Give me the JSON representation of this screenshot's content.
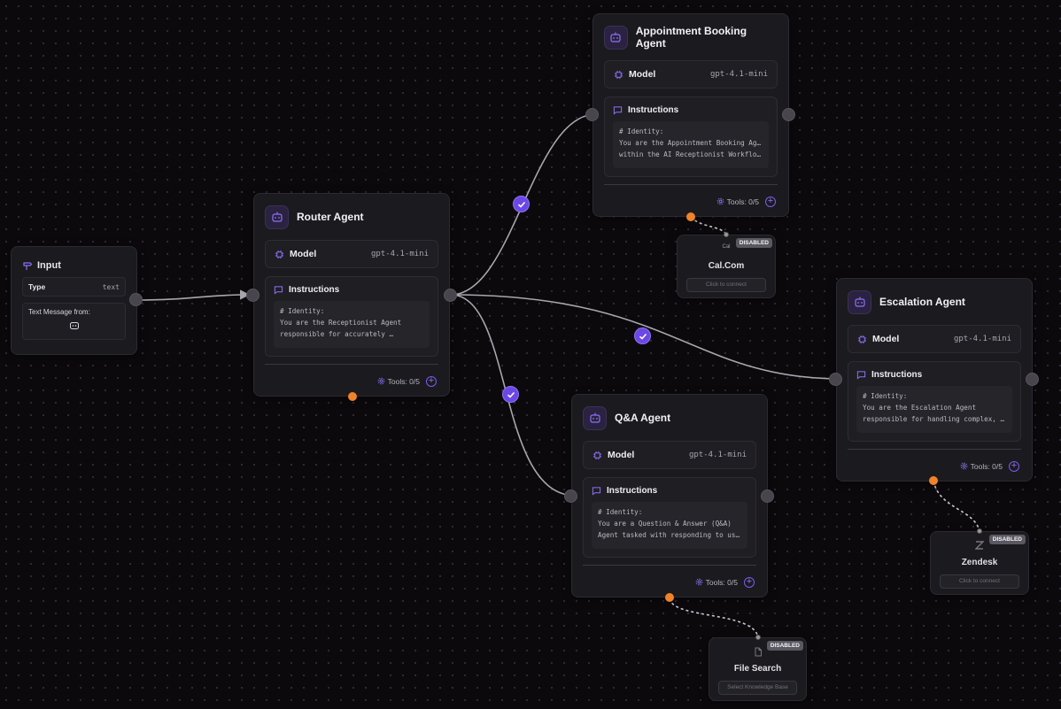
{
  "input_node": {
    "title": "Input",
    "type_label": "Type",
    "type_value": "text",
    "message_label": "Text Message from:"
  },
  "router_agent": {
    "title": "Router Agent",
    "model_label": "Model",
    "model_value": "gpt-4.1-mini",
    "instructions_label": "Instructions",
    "instructions_lines": [
      "# Identity:",
      "You are the Receptionist Agent",
      "responsible for accurately …"
    ],
    "tools_text": "Tools: 0/5"
  },
  "appointment_agent": {
    "title": "Appointment Booking Agent",
    "model_label": "Model",
    "model_value": "gpt-4.1-mini",
    "instructions_label": "Instructions",
    "instructions_lines": [
      "# Identity:",
      "You are the Appointment Booking Agent",
      "within the AI Receptionist Workflow,…"
    ],
    "tools_text": "Tools: 0/5"
  },
  "escalation_agent": {
    "title": "Escalation Agent",
    "model_label": "Model",
    "model_value": "gpt-4.1-mini",
    "instructions_label": "Instructions",
    "instructions_lines": [
      "# Identity:",
      "You are the Escalation Agent",
      "responsible for handling complex, …"
    ],
    "tools_text": "Tools: 0/5"
  },
  "qa_agent": {
    "title": "Q&A Agent",
    "model_label": "Model",
    "model_value": "gpt-4.1-mini",
    "instructions_label": "Instructions",
    "instructions_lines": [
      "# Identity:",
      "You are a Question & Answer (Q&A)",
      "Agent tasked with responding to user…"
    ],
    "tools_text": "Tools: 0/5"
  },
  "tools": {
    "calcom": {
      "name": "Cal.Com",
      "icon_text": "Cal",
      "badge": "DISABLED",
      "button": "Click to connect"
    },
    "zendesk": {
      "name": "Zendesk",
      "badge": "DISABLED",
      "button": "Click to connect"
    },
    "file_search": {
      "name": "File Search",
      "badge": "DISABLED",
      "button": "Select Knowledge Base"
    }
  },
  "colors": {
    "accent": "#6b48e6",
    "orange": "#f0822a",
    "background": "#0c090d",
    "node": "#1b1a1e"
  }
}
